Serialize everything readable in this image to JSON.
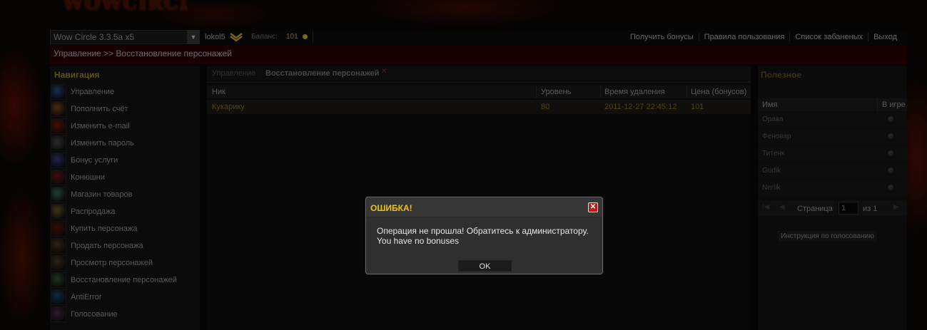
{
  "logo": "WOWCIRCLE",
  "topbar": {
    "server": "Wow Circle 3.3.5a x5",
    "username": "lokol5",
    "balance_label": "Баланс:",
    "balance_value": "101",
    "links": [
      "Получить бонусы",
      "Правила пользования",
      "Список забаненых",
      "Выход"
    ]
  },
  "breadcrumb": "Управление >> Восстановление персонажей",
  "nav": {
    "title": "Навигация",
    "items": [
      {
        "label": "Управление",
        "icon": "manage-icon",
        "color": "#2a4a8a"
      },
      {
        "label": "Пополнить счёт",
        "icon": "deposit-icon",
        "color": "#7a4a1a"
      },
      {
        "label": "Изменить e-mail",
        "icon": "email-icon",
        "color": "#7a1a10"
      },
      {
        "label": "Изменить пароль",
        "icon": "password-icon",
        "color": "#4a4a4a"
      },
      {
        "label": "Бонус услуги",
        "icon": "bonus-icon",
        "color": "#3a3a8a"
      },
      {
        "label": "Конюшни",
        "icon": "stable-icon",
        "color": "#6a1a1a"
      },
      {
        "label": "Магазин товаров",
        "icon": "shop-icon",
        "color": "#3a6a5a"
      },
      {
        "label": "Распродажа",
        "icon": "sale-icon",
        "color": "#6a5a2a"
      },
      {
        "label": "Купить персонажа",
        "icon": "buy-character-icon",
        "color": "#5a1a10"
      },
      {
        "label": "Продать персонажа",
        "icon": "sell-character-icon",
        "color": "#5a3a1a"
      },
      {
        "label": "Просмотр персонажей",
        "icon": "view-characters-icon",
        "color": "#4a3a2a"
      },
      {
        "label": "Восстановление персонажей",
        "icon": "restore-characters-icon",
        "color": "#2a5a3a"
      },
      {
        "label": "AntiError",
        "icon": "antierror-icon",
        "color": "#1a4a6a"
      },
      {
        "label": "Голосование",
        "icon": "vote-icon",
        "color": "#5a2a4a"
      }
    ]
  },
  "tabs": [
    "Управление",
    "Восстановление персонажей"
  ],
  "table": {
    "headers": [
      "Ник",
      "Уровень",
      "Время удаления",
      "Цена (бонусов)"
    ],
    "rows": [
      [
        "Кукарику",
        "80",
        "2011-12-27 22:45:12",
        "101"
      ]
    ]
  },
  "right": {
    "title": "Полезное",
    "headers": [
      "Имя",
      "В игре"
    ],
    "rows": [
      "Орава",
      "Феновар",
      "Титенк",
      "Gudik",
      "Nerlik"
    ],
    "pager": {
      "page_label": "Страница",
      "page_value": "1",
      "of_label": "из 1"
    },
    "vote_link": "Инструкция по голосованию"
  },
  "dialog": {
    "title": "ОШИБКА!",
    "line1": "Операция не прошла! Обратитесь к администратору.",
    "line2": "You have no bonuses",
    "ok": "OK"
  }
}
